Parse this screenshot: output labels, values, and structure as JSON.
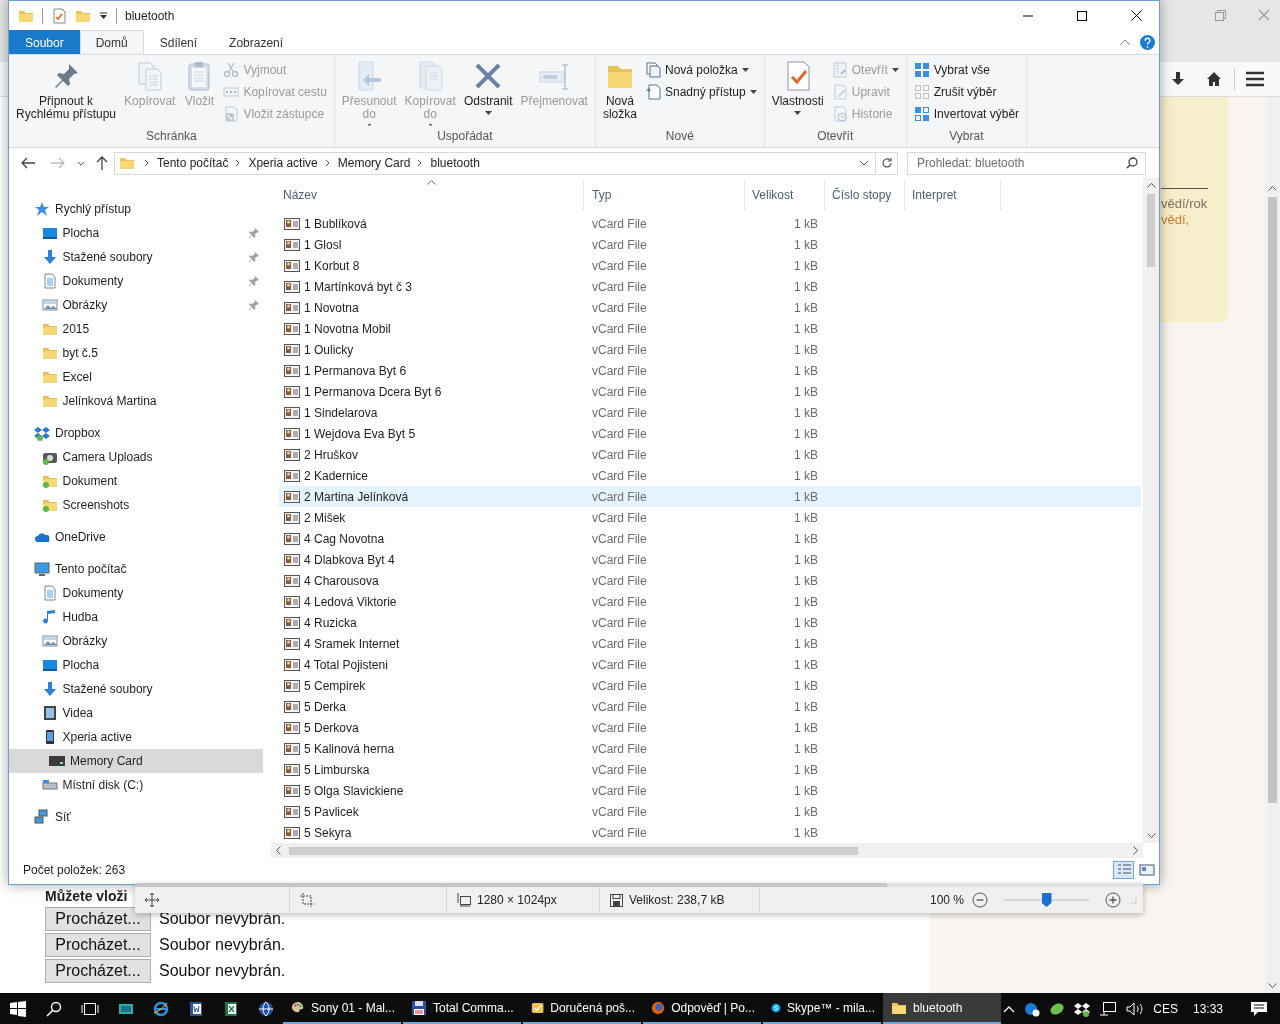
{
  "explorer": {
    "title": "bluetooth",
    "ribbon_tabs": [
      {
        "label": "Soubor",
        "kind": "menu",
        "selected": false
      },
      {
        "label": "Domů",
        "kind": "tab",
        "selected": true
      },
      {
        "label": "Sdílení",
        "kind": "tab",
        "selected": false
      },
      {
        "label": "Zobrazení",
        "kind": "tab",
        "selected": false
      }
    ],
    "ribbon_groups": [
      {
        "label": "Schránka",
        "commands": [
          {
            "label": "Připnout k\nRychlému přístupu",
            "kind": "large",
            "disabled": false,
            "dropdown": false
          },
          {
            "label": "Kopírovat",
            "kind": "large",
            "disabled": true,
            "dropdown": false
          },
          {
            "label": "Vložit",
            "kind": "large",
            "disabled": true,
            "dropdown": false
          },
          {
            "label": "Vyjmout",
            "kind": "small",
            "disabled": true,
            "dropdown": false
          },
          {
            "label": "Kopírovat cestu",
            "kind": "small",
            "disabled": true,
            "dropdown": false
          },
          {
            "label": "Vložit zástupce",
            "kind": "small",
            "disabled": true,
            "dropdown": false
          }
        ]
      },
      {
        "label": "Uspořádat",
        "commands": [
          {
            "label": "Přesunout\ndo",
            "kind": "large",
            "disabled": true,
            "dropdown": true
          },
          {
            "label": "Kopírovat\ndo",
            "kind": "large",
            "disabled": true,
            "dropdown": true
          },
          {
            "label": "Odstranit",
            "kind": "large",
            "disabled": false,
            "dropdown": true
          },
          {
            "label": "Přejmenovat",
            "kind": "large",
            "disabled": true,
            "dropdown": false
          }
        ]
      },
      {
        "label": "Nové",
        "commands": [
          {
            "label": "Nová\nsložka",
            "kind": "large",
            "disabled": false,
            "dropdown": false
          },
          {
            "label": "Nová položka",
            "kind": "small",
            "disabled": false,
            "dropdown": true
          },
          {
            "label": "Snadný přístup",
            "kind": "small",
            "disabled": false,
            "dropdown": true
          }
        ]
      },
      {
        "label": "Otevřít",
        "commands": [
          {
            "label": "Vlastnosti",
            "kind": "large",
            "disabled": false,
            "dropdown": true
          },
          {
            "label": "Otevřít",
            "kind": "small",
            "disabled": true,
            "dropdown": true
          },
          {
            "label": "Upravit",
            "kind": "small",
            "disabled": true,
            "dropdown": false
          },
          {
            "label": "Historie",
            "kind": "small",
            "disabled": true,
            "dropdown": false
          }
        ]
      },
      {
        "label": "Vybrat",
        "commands": [
          {
            "label": "Vybrat vše",
            "kind": "small",
            "disabled": false,
            "dropdown": false
          },
          {
            "label": "Zrušit výběr",
            "kind": "small",
            "disabled": false,
            "dropdown": false
          },
          {
            "label": "Invertovat výběr",
            "kind": "small",
            "disabled": false,
            "dropdown": false
          }
        ]
      }
    ],
    "address": {
      "crumbs": [
        "Tento počítač",
        "Xperia active",
        "Memory Card",
        "bluetooth"
      ]
    },
    "search": {
      "placeholder": "Prohledat: bluetooth"
    },
    "nav": [
      {
        "label": "Rychlý přístup",
        "kind": "star",
        "selected": false,
        "children": [
          {
            "label": "Plocha",
            "kind": "desktop",
            "pinned": true,
            "selected": false
          },
          {
            "label": "Stažené soubory",
            "kind": "download",
            "pinned": true,
            "selected": false
          },
          {
            "label": "Dokumenty",
            "kind": "documents",
            "pinned": true,
            "selected": false
          },
          {
            "label": "Obrázky",
            "kind": "pictures",
            "pinned": true,
            "selected": false
          },
          {
            "label": "2015",
            "kind": "folder",
            "pinned": false,
            "selected": false
          },
          {
            "label": "byt č.5",
            "kind": "folder",
            "pinned": false,
            "selected": false
          },
          {
            "label": "Excel",
            "kind": "folder",
            "pinned": false,
            "selected": false
          },
          {
            "label": "Jelínková Martina",
            "kind": "folder",
            "pinned": false,
            "selected": false
          }
        ]
      },
      {
        "label": "Dropbox",
        "kind": "dropbox",
        "selected": false,
        "children": [
          {
            "label": "Camera Uploads",
            "kind": "camera",
            "selected": false
          },
          {
            "label": "Dokument",
            "kind": "synced",
            "selected": false
          },
          {
            "label": "Screenshots",
            "kind": "synced",
            "selected": false
          }
        ]
      },
      {
        "label": "OneDrive",
        "kind": "cloud",
        "selected": false
      },
      {
        "label": "Tento počítač",
        "kind": "computer",
        "selected": false,
        "children": [
          {
            "label": "Dokumenty",
            "kind": "documents",
            "selected": false
          },
          {
            "label": "Hudba",
            "kind": "music",
            "selected": false
          },
          {
            "label": "Obrázky",
            "kind": "pictures",
            "selected": false
          },
          {
            "label": "Plocha",
            "kind": "desktop",
            "selected": false
          },
          {
            "label": "Stažené soubory",
            "kind": "download",
            "selected": false
          },
          {
            "label": "Videa",
            "kind": "videos",
            "selected": false
          },
          {
            "label": "Xperia active",
            "kind": "phone",
            "selected": false,
            "children": [
              {
                "label": "Memory Card",
                "kind": "card",
                "selected": true
              }
            ]
          },
          {
            "label": "Místní disk (C:)",
            "kind": "disk",
            "selected": false
          }
        ]
      },
      {
        "label": "Síť",
        "kind": "network",
        "selected": false
      }
    ],
    "columns": [
      {
        "label": "Název",
        "sorted": true
      },
      {
        "label": "Typ",
        "sorted": false
      },
      {
        "label": "Velikost",
        "sorted": false
      },
      {
        "label": "Číslo stopy",
        "sorted": false
      },
      {
        "label": "Interpret",
        "sorted": false
      }
    ],
    "rows": [
      {
        "name": "1 Bublíková",
        "type": "vCard File",
        "size": "1 kB",
        "selected": false
      },
      {
        "name": "1 Glosl",
        "type": "vCard File",
        "size": "1 kB",
        "selected": false
      },
      {
        "name": "1 Korbut 8",
        "type": "vCard File",
        "size": "1 kB",
        "selected": false
      },
      {
        "name": "1 Martínková byt č 3",
        "type": "vCard File",
        "size": "1 kB",
        "selected": false
      },
      {
        "name": "1 Novotna",
        "type": "vCard File",
        "size": "1 kB",
        "selected": false
      },
      {
        "name": "1 Novotna Mobil",
        "type": "vCard File",
        "size": "1 kB",
        "selected": false
      },
      {
        "name": "1 Oulicky",
        "type": "vCard File",
        "size": "1 kB",
        "selected": false
      },
      {
        "name": "1 Permanova Byt 6",
        "type": "vCard File",
        "size": "1 kB",
        "selected": false
      },
      {
        "name": "1 Permanova Dcera Byt 6",
        "type": "vCard File",
        "size": "1 kB",
        "selected": false
      },
      {
        "name": "1 Sindelarova",
        "type": "vCard File",
        "size": "1 kB",
        "selected": false
      },
      {
        "name": "1 Wejdova Eva Byt 5",
        "type": "vCard File",
        "size": "1 kB",
        "selected": false
      },
      {
        "name": "2 Hruškov",
        "type": "vCard File",
        "size": "1 kB",
        "selected": false
      },
      {
        "name": "2 Kadernice",
        "type": "vCard File",
        "size": "1 kB",
        "selected": false
      },
      {
        "name": "2 Martina Jelínková",
        "type": "vCard File",
        "size": "1 kB",
        "selected": true
      },
      {
        "name": "2 Mišek",
        "type": "vCard File",
        "size": "1 kB",
        "selected": false
      },
      {
        "name": "4 Cag Novotna",
        "type": "vCard File",
        "size": "1 kB",
        "selected": false
      },
      {
        "name": "4 Dlabkova Byt 4",
        "type": "vCard File",
        "size": "1 kB",
        "selected": false
      },
      {
        "name": "4 Charousova",
        "type": "vCard File",
        "size": "1 kB",
        "selected": false
      },
      {
        "name": "4 Ledová Viktorie",
        "type": "vCard File",
        "size": "1 kB",
        "selected": false
      },
      {
        "name": "4 Ruzicka",
        "type": "vCard File",
        "size": "1 kB",
        "selected": false
      },
      {
        "name": "4 Sramek Internet",
        "type": "vCard File",
        "size": "1 kB",
        "selected": false
      },
      {
        "name": "4 Total Pojisteni",
        "type": "vCard File",
        "size": "1 kB",
        "selected": false
      },
      {
        "name": "5 Cempirek",
        "type": "vCard File",
        "size": "1 kB",
        "selected": false
      },
      {
        "name": "5 Derka",
        "type": "vCard File",
        "size": "1 kB",
        "selected": false
      },
      {
        "name": "5 Derkova",
        "type": "vCard File",
        "size": "1 kB",
        "selected": false
      },
      {
        "name": "5 Kalinová herna",
        "type": "vCard File",
        "size": "1 kB",
        "selected": false
      },
      {
        "name": "5 Limburska",
        "type": "vCard File",
        "size": "1 kB",
        "selected": false
      },
      {
        "name": "5 Olga Slavickiene",
        "type": "vCard File",
        "size": "1 kB",
        "selected": false
      },
      {
        "name": "5 Pavlicek",
        "type": "vCard File",
        "size": "1 kB",
        "selected": false
      },
      {
        "name": "5 Sekyra",
        "type": "vCard File",
        "size": "1 kB",
        "selected": false
      }
    ],
    "status": "Počet položek: 263",
    "view_buttons": [
      {
        "selected": true
      },
      {
        "selected": false
      }
    ]
  },
  "browser": {
    "note_lines": [
      {
        "text": "vědí/rok",
        "kind": "text"
      },
      {
        "text": "vědí,",
        "kind": "link"
      }
    ],
    "form_heading": "Můžete vloži",
    "uploads": [
      {
        "button": "Procházet...",
        "status": "Soubor nevybrán."
      },
      {
        "button": "Procházet...",
        "status": "Soubor nevybrán."
      },
      {
        "button": "Procházet...",
        "status": "Soubor nevybrán."
      }
    ]
  },
  "viewer_bar": {
    "dimensions": "1280 × 1024px",
    "file_size": "Velikost: 238,7 kB",
    "zoom": "100 %",
    "zoom_slider": {
      "level": 0.5
    }
  },
  "taskbar": {
    "windows": [
      {
        "label": "Sony 01 - Mal...",
        "kind": "paint",
        "selected": false
      },
      {
        "label": "Total Comma...",
        "kind": "floppy",
        "selected": false
      },
      {
        "label": "Doručená poš...",
        "kind": "mail",
        "selected": false
      },
      {
        "label": "Odpověď | Po...",
        "kind": "firefox",
        "selected": false
      },
      {
        "label": "Skype™ - mila...",
        "kind": "skype",
        "selected": false
      },
      {
        "label": "bluetooth",
        "kind": "folder",
        "selected": true
      }
    ],
    "language": "CES",
    "time": "13:33"
  }
}
